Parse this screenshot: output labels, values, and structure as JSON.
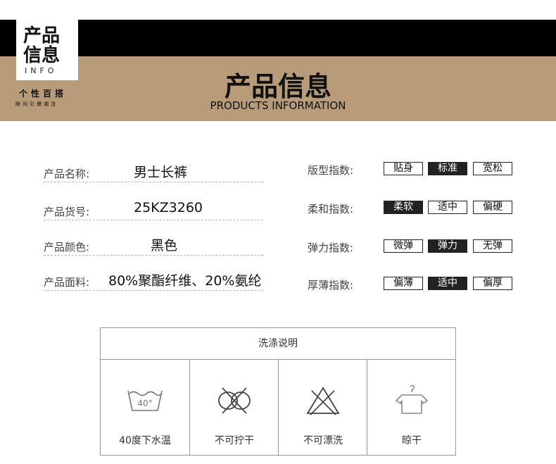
{
  "header": {
    "logo_line1": "产品",
    "logo_line2": "信息",
    "logo_info": "INFO",
    "slogan": "个性百搭",
    "slogan_sub": "瞬间引爆潮流",
    "title": "产品信息",
    "subtitle": "PRODUCTS INFORMATION"
  },
  "info": [
    {
      "label": "产品名称:",
      "value": "男士长裤"
    },
    {
      "label": "产品货号:",
      "value": "25KZ3260"
    },
    {
      "label": "产品颜色:",
      "value": "黑色"
    },
    {
      "label": "产品面料:",
      "value": "80%聚酯纤维、20%氨纶"
    }
  ],
  "indices": [
    {
      "label": "版型指数:",
      "options": [
        "贴身",
        "标准",
        "宽松"
      ],
      "selected": 1
    },
    {
      "label": "柔和指数:",
      "options": [
        "柔软",
        "适中",
        "偏硬"
      ],
      "selected": 0
    },
    {
      "label": "弹力指数:",
      "options": [
        "微弹",
        "弹力",
        "无弹"
      ],
      "selected": 1
    },
    {
      "label": "厚薄指数:",
      "options": [
        "偏薄",
        "适中",
        "偏厚"
      ],
      "selected": 1
    }
  ],
  "care": {
    "title": "洗涤说明",
    "wash_temp": "40°",
    "items": [
      {
        "label": "40度下水温",
        "icon": "wash-40-icon"
      },
      {
        "label": "不可拧干",
        "icon": "no-wring-icon"
      },
      {
        "label": "不可漂洗",
        "icon": "no-bleach-icon"
      },
      {
        "label": "晾干",
        "icon": "hang-dry-icon"
      }
    ]
  },
  "colors": {
    "band": "#b89b78",
    "bar": "#000000",
    "selected": "#222222"
  }
}
